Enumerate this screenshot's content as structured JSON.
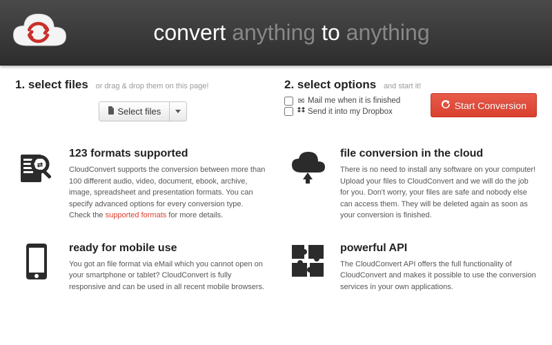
{
  "header": {
    "tagline_prefix": "convert ",
    "tagline_word1": "anything",
    "tagline_mid": " to ",
    "tagline_word2": "anything"
  },
  "step1": {
    "title": "1. select files",
    "hint": "or drag & drop them on this page!",
    "select_files_label": "Select files"
  },
  "step2": {
    "title": "2. select options",
    "hint": "and start it!",
    "option_mail": "Mail me when it is finished",
    "option_dropbox": "Send it into my Dropbox",
    "start_label": "Start Conversion"
  },
  "features": {
    "f1": {
      "title": "123 formats supported",
      "desc_a": "CloudConvert supports the conversion between more than 100 different audio, video, document, ebook, archive, image, spreadsheet and presentation formats. You can specify advanced options for every conversion type. Check the ",
      "desc_link": "supported formats",
      "desc_b": " for more details."
    },
    "f2": {
      "title": "file conversion in the cloud",
      "desc": "There is no need to install any software on your computer! Upload your files to CloudConvert and we will do the job for you. Don't worry, your files are safe and nobody else can access them. They will be deleted again as soon as your conversion is finished."
    },
    "f3": {
      "title": "ready for mobile use",
      "desc": "You got an file format via eMail which you cannot open on your smartphone or tablet? CloudConvert is fully responsive and can be used in all recent mobile browsers."
    },
    "f4": {
      "title": "powerful API",
      "desc": "The CloudConvert API offers the full functionality of CloudConvert and makes it possible to use the conversion services in your own applications."
    }
  }
}
